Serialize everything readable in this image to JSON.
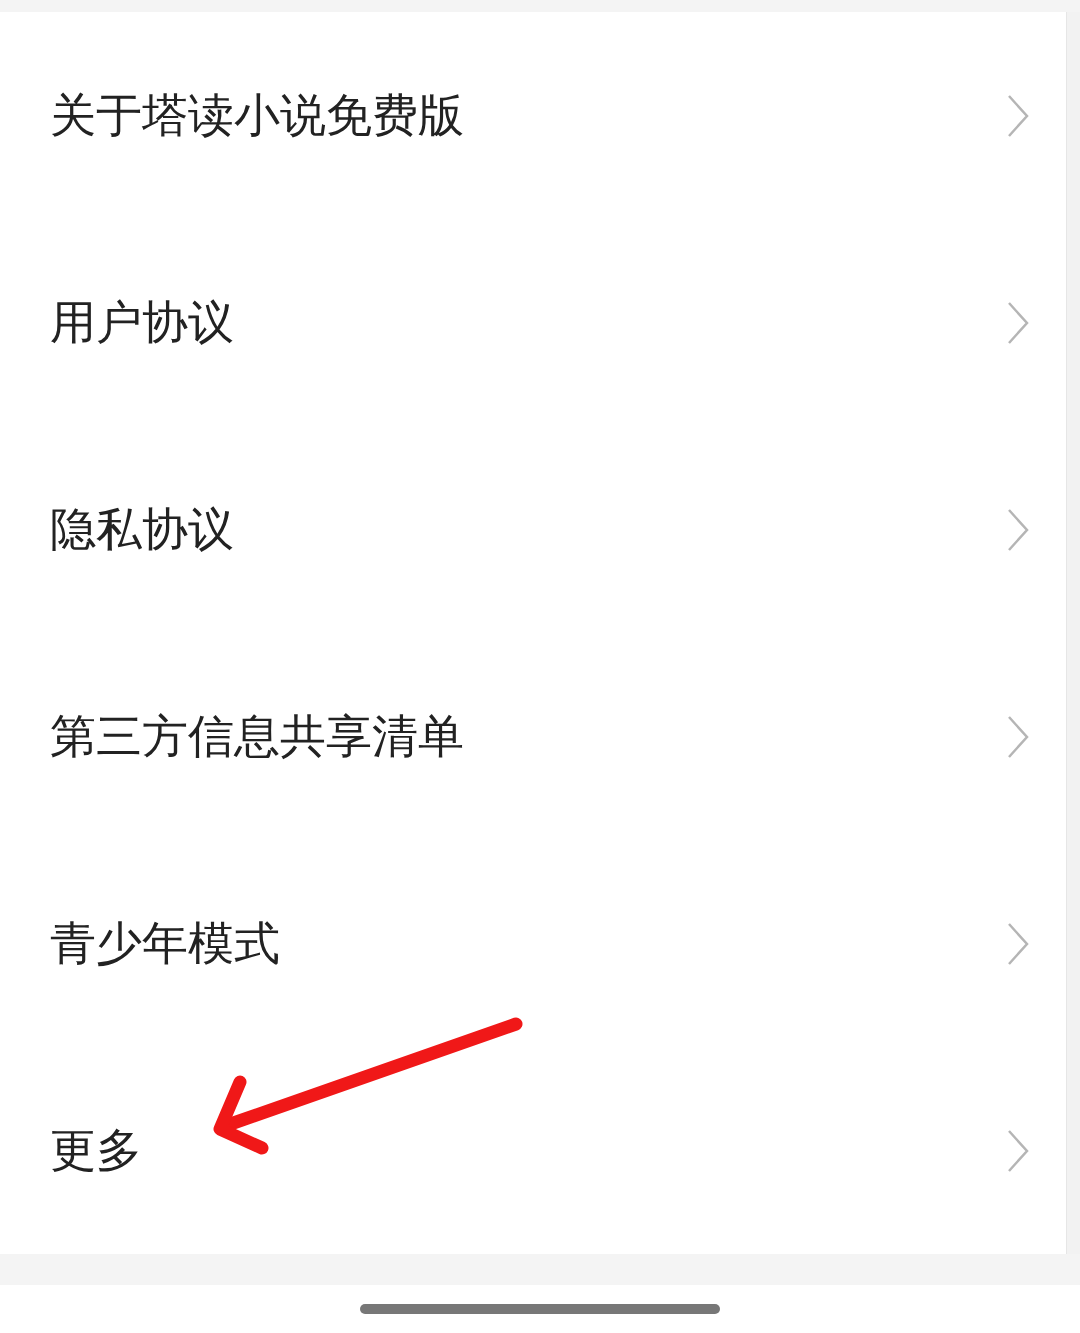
{
  "menu": {
    "items": [
      {
        "label": "关于塔读小说免费版"
      },
      {
        "label": "用户协议"
      },
      {
        "label": "隐私协议"
      },
      {
        "label": "第三方信息共享清单"
      },
      {
        "label": "青少年模式"
      },
      {
        "label": "更多"
      }
    ]
  }
}
